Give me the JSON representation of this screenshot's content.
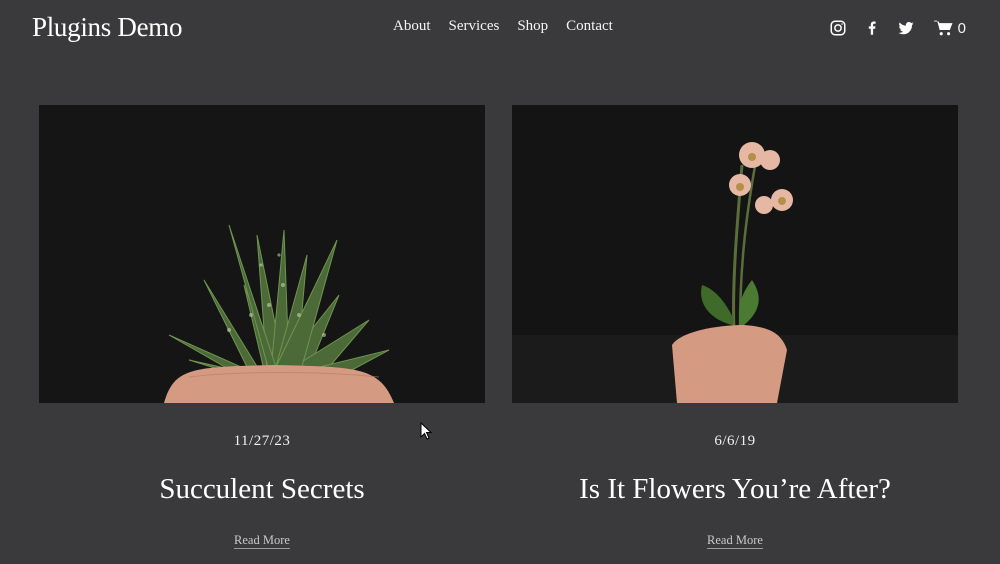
{
  "header": {
    "site_title": "Plugins Demo",
    "nav": [
      "About",
      "Services",
      "Shop",
      "Contact"
    ],
    "social_icons": [
      "instagram-icon",
      "facebook-icon",
      "twitter-icon"
    ],
    "cart_count": "0"
  },
  "posts": [
    {
      "date": "11/27/23",
      "title": "Succulent Secrets",
      "read_more": "Read More",
      "image": "succulent-in-clay-pot"
    },
    {
      "date": "6/6/19",
      "title": "Is It Flowers You’re After?",
      "read_more": "Read More",
      "image": "orchid-in-clay-pot"
    }
  ],
  "colors": {
    "background": "#3a3a3c",
    "text": "#ffffff",
    "photo_bg": "#141414",
    "pot": "#d39a82"
  }
}
